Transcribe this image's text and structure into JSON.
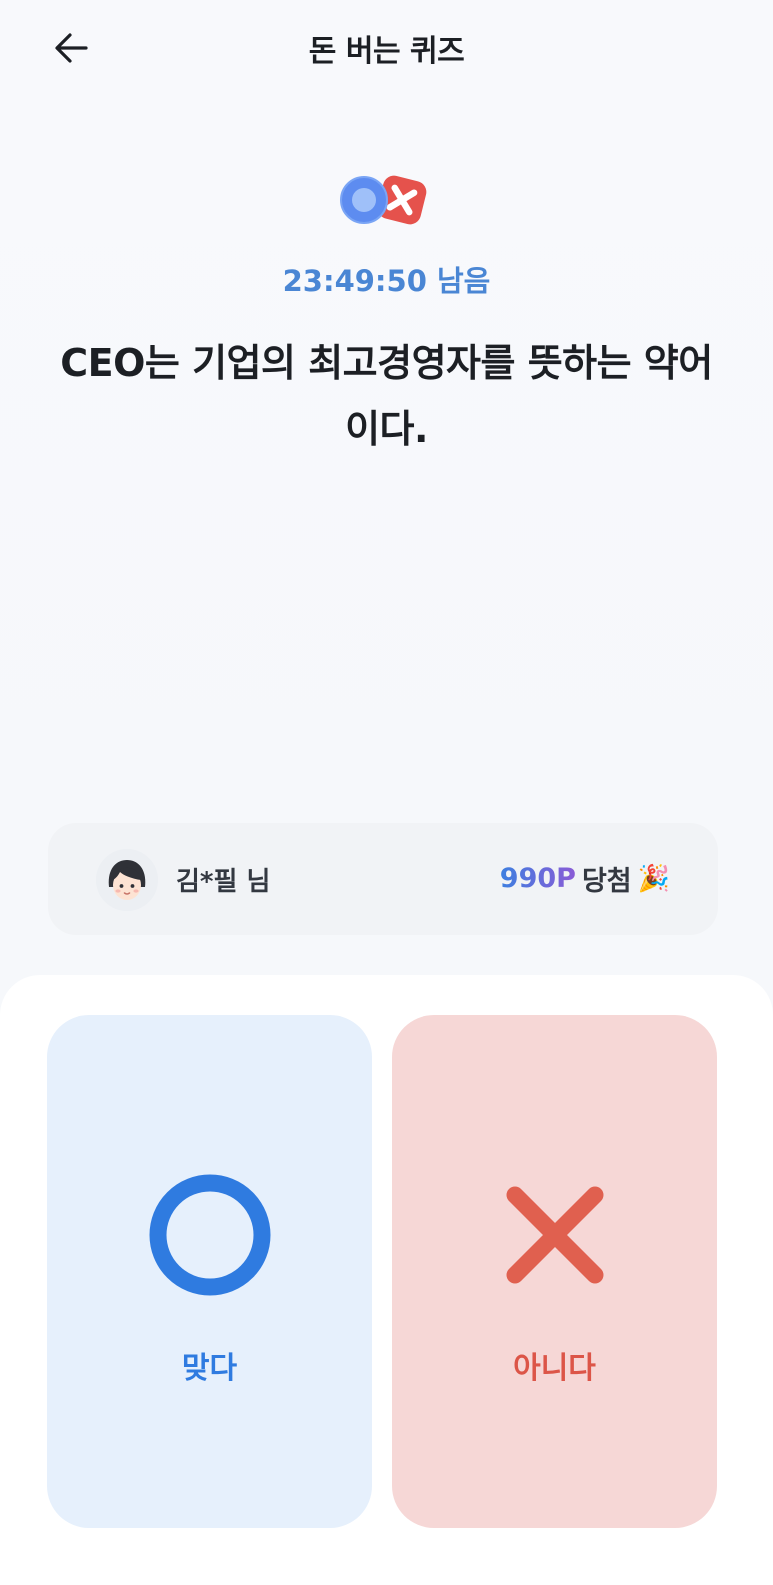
{
  "header": {
    "title": "돈 버는 퀴즈",
    "back_icon": "arrow-left-icon"
  },
  "quiz": {
    "logo_icon": "ox-logo-icon",
    "timer_text": "23:49:50 남음",
    "question": "CEO는 기업의 최고경영자를 뜻하는 약어이다."
  },
  "winner": {
    "avatar_icon": "user-avatar-icon",
    "name": "김*필 님",
    "prize_points": "990P",
    "prize_label": "당첨",
    "emoji": "🎉"
  },
  "answers": {
    "true_label": "맞다",
    "false_label": "아니다",
    "true_icon": "circle-o-icon",
    "false_icon": "cross-x-icon"
  },
  "colors": {
    "accent_blue": "#2f7be0",
    "accent_red": "#dc5548",
    "true_bg": "#e6f0fc",
    "false_bg": "#f6d7d6",
    "timer": "#4a86d4"
  }
}
